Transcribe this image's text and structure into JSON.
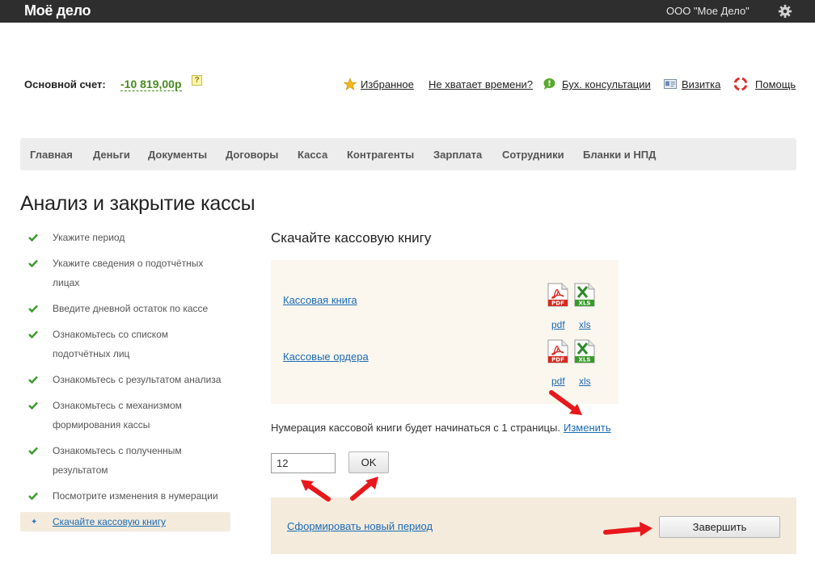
{
  "header": {
    "logo": "Моё дело",
    "org_name": "ООО \"Мое Дело\"",
    "settings_icon": "gear-icon"
  },
  "account": {
    "label": "Основной счет:",
    "value": "-10 819,00р",
    "help_icon": "?",
    "value_color": "#4a8a1f"
  },
  "toplinks": [
    {
      "label": "Избранное",
      "icon": "star-icon"
    },
    {
      "label": "Не хватает времени?",
      "icon": ""
    },
    {
      "label": "Бух. консультации",
      "icon": "chat-bubble-icon"
    },
    {
      "label": "Визитка",
      "icon": "card-icon"
    },
    {
      "label": "Помощь",
      "icon": "lifebuoy-icon"
    }
  ],
  "nav": [
    "Главная",
    "Деньги",
    "Документы",
    "Договоры",
    "Касса",
    "Контрагенты",
    "Зарплата",
    "Сотрудники",
    "Бланки и НПД"
  ],
  "page_title": "Анализ и закрытие кассы",
  "steps": [
    {
      "label": "Укажите период",
      "done": true
    },
    {
      "label": "Укажите сведения о подотчётных лицах",
      "done": true
    },
    {
      "label": "Введите дневной остаток по кассе",
      "done": true
    },
    {
      "label": "Ознакомьтесь со списком подотчётных лиц",
      "done": true
    },
    {
      "label": "Ознакомьтесь с результатом анализа",
      "done": true
    },
    {
      "label": "Ознакомьтесь с механизмом формирования кассы",
      "done": true
    },
    {
      "label": "Ознакомьтесь с полученным результатом",
      "done": true
    },
    {
      "label": "Посмотрите изменения в нумерации",
      "done": true
    },
    {
      "label": "Скачайте кассовую книгу",
      "done": false,
      "current": true
    }
  ],
  "content": {
    "section_title": "Скачайте кассовую книгу",
    "documents": [
      {
        "label": "Кассовая книга",
        "pdf": "pdf",
        "xls": "xls"
      },
      {
        "label": "Кассовые ордера",
        "pdf": "pdf",
        "xls": "xls"
      }
    ],
    "numbering_text": "Нумерация кассовой книги будет начинаться с 1 страницы.",
    "change_link": "Изменить",
    "page_input_value": "12",
    "ok_label": "OK",
    "new_period_link": "Сформировать новый период",
    "finish_label": "Завершить"
  },
  "colors": {
    "topbar": "#2e2e2e",
    "link": "#1a6ab4",
    "check": "#3a9a2a",
    "annotation_arrow": "#e8171b"
  }
}
